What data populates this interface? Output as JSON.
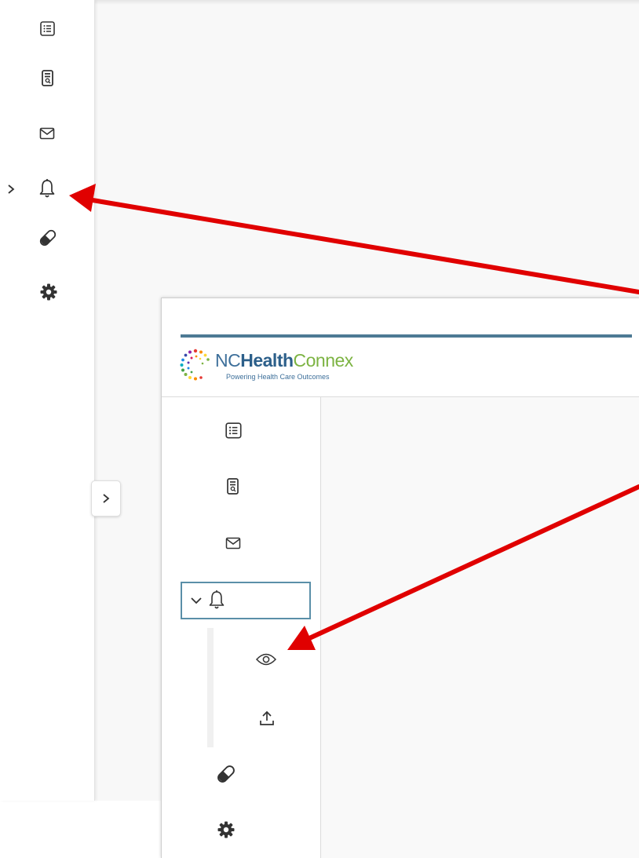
{
  "top_sidebar": {
    "items": [
      {
        "icon": "list-icon"
      },
      {
        "icon": "document-search-icon"
      },
      {
        "icon": "mail-icon"
      },
      {
        "icon": "bell-icon",
        "expander": "chevron-right-icon"
      },
      {
        "icon": "pill-icon"
      },
      {
        "icon": "gear-icon"
      }
    ],
    "expand_tab_icon": "chevron-right-icon"
  },
  "inset": {
    "logo": {
      "nc": "NC",
      "health": "Health",
      "connex": "Connex",
      "tagline": "Powering Health Care Outcomes"
    },
    "sidebar": {
      "items": [
        {
          "icon": "list-icon"
        },
        {
          "icon": "document-search-icon"
        },
        {
          "icon": "mail-icon"
        },
        {
          "icon": "bell-icon",
          "expander": "chevron-down-icon",
          "active": true
        },
        {
          "icon": "eye-icon",
          "submenu": true
        },
        {
          "icon": "upload-icon",
          "submenu": true
        },
        {
          "icon": "pill-icon"
        },
        {
          "icon": "gear-icon"
        }
      ]
    }
  },
  "colors": {
    "annotation_arrow": "#e00000",
    "active_border": "#5a8fa8",
    "brand_blue": "#2c5f8a",
    "brand_green": "#7cb342",
    "header_rule": "#4d7a94"
  }
}
